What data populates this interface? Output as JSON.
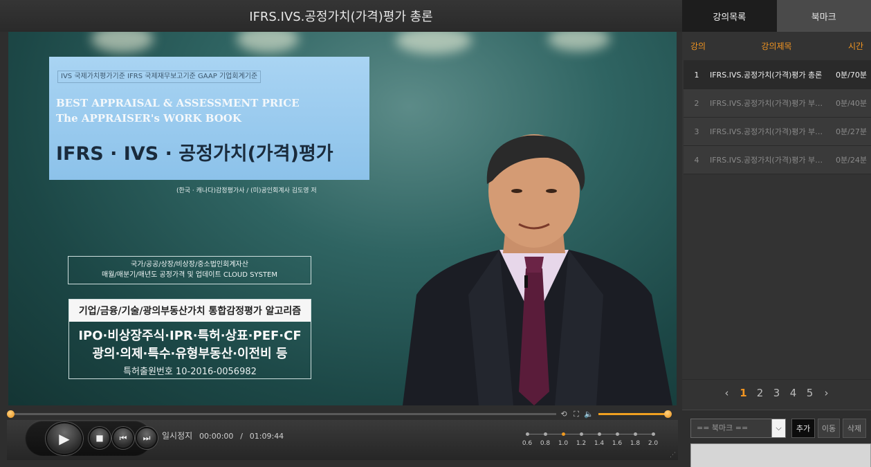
{
  "window": {
    "title": "IFRS.IVS.공정가치(가격)평가 총론"
  },
  "video": {
    "book_standards": "IVS 국제가치평가기준  IFRS 국제재무보고기준  GAAP 기업회계기준",
    "book_en_line1": "BEST APPRAISAL & ASSESSMENT PRICE",
    "book_en_line2": "The APPRAISER's WORK BOOK",
    "book_main_title": "IFRS · IVS · 공정가치(가격)평가",
    "book_author": "(한국 · 캐나다)감정평가사 / (미)공인회계사   김도영 저",
    "box1_line1": "국가/공공/상장/비상장/중소법인회계자산",
    "box1_line2": "매월/매분기/매년도 공정가격 및 업데이트 CLOUD SYSTEM",
    "box2_heading": "기업/금융/기술/광의부동산가치 통합감정평가 알고리즘",
    "box2_line1": "IPO·비상장주식·IPR·특허·상표·PEF·CF",
    "box2_line2": "광의·의제·특수·유형부동산·이전비 등",
    "box2_line3": "특허출원번호 10-2016-0056982"
  },
  "player": {
    "status": "일시정지",
    "current_time": "00:00:00",
    "separator": "/",
    "total_time": "01:09:44",
    "seek_progress": 0.0,
    "volume_level": 1.0,
    "speeds": [
      "0.6",
      "0.8",
      "1.0",
      "1.2",
      "1.4",
      "1.6",
      "1.8",
      "2.0"
    ],
    "selected_speed": "1.0",
    "accent_color": "#f29521"
  },
  "panel": {
    "tabs": [
      {
        "label": "강의목록"
      },
      {
        "label": "북마크"
      }
    ],
    "columns": {
      "num": "강의",
      "title": "강의제목",
      "time": "시간"
    },
    "lectures": [
      {
        "num": "1",
        "title": "IFRS.IVS.공정가치(가격)평가 총론",
        "time": "0분/70분"
      },
      {
        "num": "2",
        "title": "IFRS.IVS.공정가치(가격)평가 부…",
        "time": "0분/40분"
      },
      {
        "num": "3",
        "title": "IFRS.IVS.공정가치(가격)평가 부…",
        "time": "0분/27분"
      },
      {
        "num": "4",
        "title": "IFRS.IVS.공정가치(가격)평가 부…",
        "time": "0분/24분"
      }
    ],
    "pager": {
      "prev": "‹",
      "pages": [
        "1",
        "2",
        "3",
        "4",
        "5"
      ],
      "next": "›",
      "current": "1"
    },
    "bookmark": {
      "select_value": "== 북마크 ==",
      "add_label": "추가",
      "move_label": "이동",
      "delete_label": "삭제"
    }
  }
}
